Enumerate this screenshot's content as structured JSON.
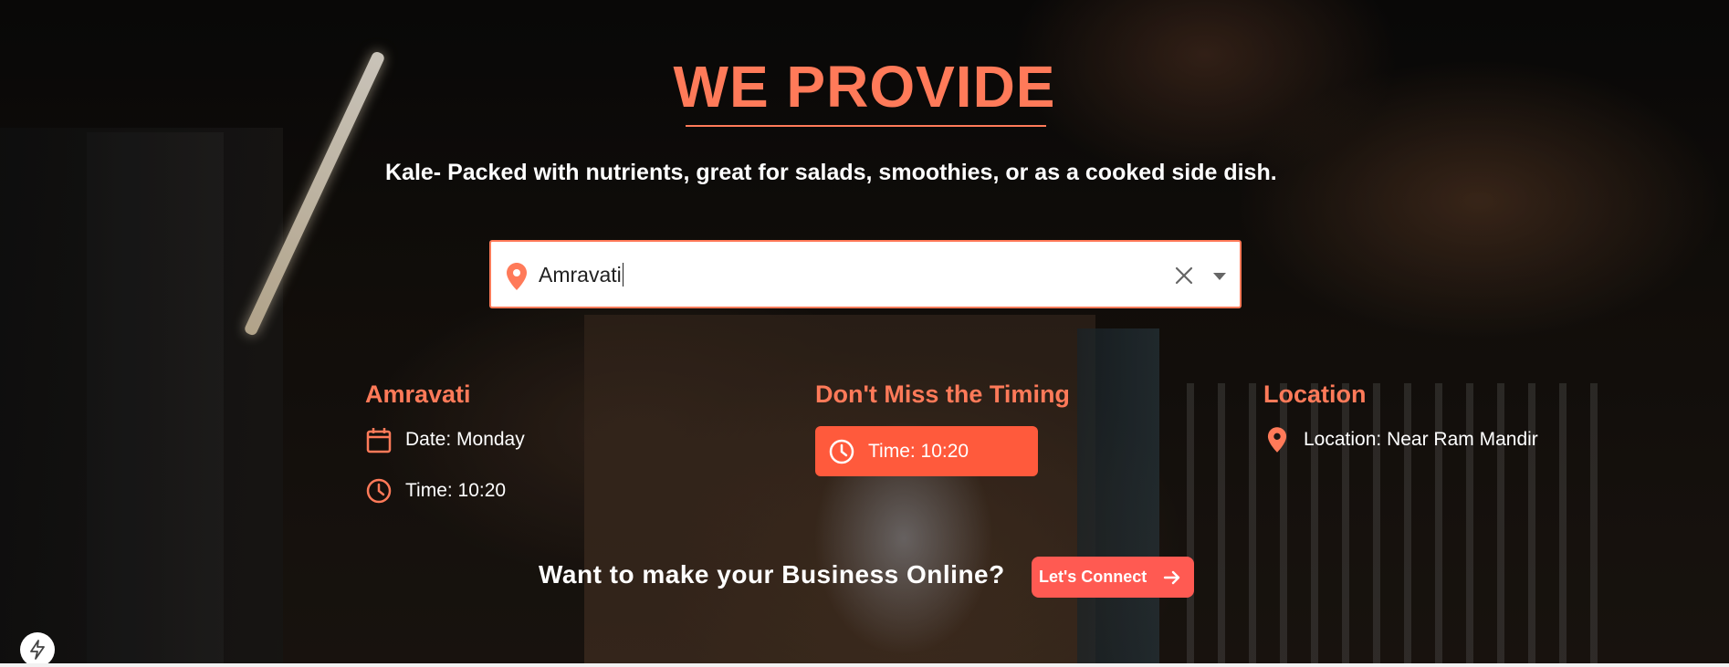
{
  "hero": {
    "title": "WE PROVIDE",
    "subtitle": "Kale- Packed with nutrients, great for salads, smoothies, or as a cooked side dish."
  },
  "search": {
    "value": "Amravati",
    "icon": "location-pin-icon",
    "clear_icon": "close-icon",
    "dropdown_icon": "chevron-down-icon"
  },
  "columns": {
    "city": {
      "title": "Amravati",
      "date_label": "Date: Monday",
      "date_icon": "calendar-icon",
      "time_label": "Time: 10:20",
      "time_icon": "clock-icon"
    },
    "timing": {
      "title": "Don't Miss the Timing",
      "time_label": "Time: 10:20",
      "time_icon": "clock-icon"
    },
    "location": {
      "title": "Location",
      "location_label": "Location: Near Ram Mandir",
      "location_icon": "location-pin-icon"
    }
  },
  "cta": {
    "text": "Want to make your Business Online?",
    "button_label": "Let's Connect",
    "button_icon": "arrow-right-icon"
  },
  "colors": {
    "accent": "#ff7a59",
    "button": "#ff5a3c",
    "cta_button": "#ff5a52"
  }
}
